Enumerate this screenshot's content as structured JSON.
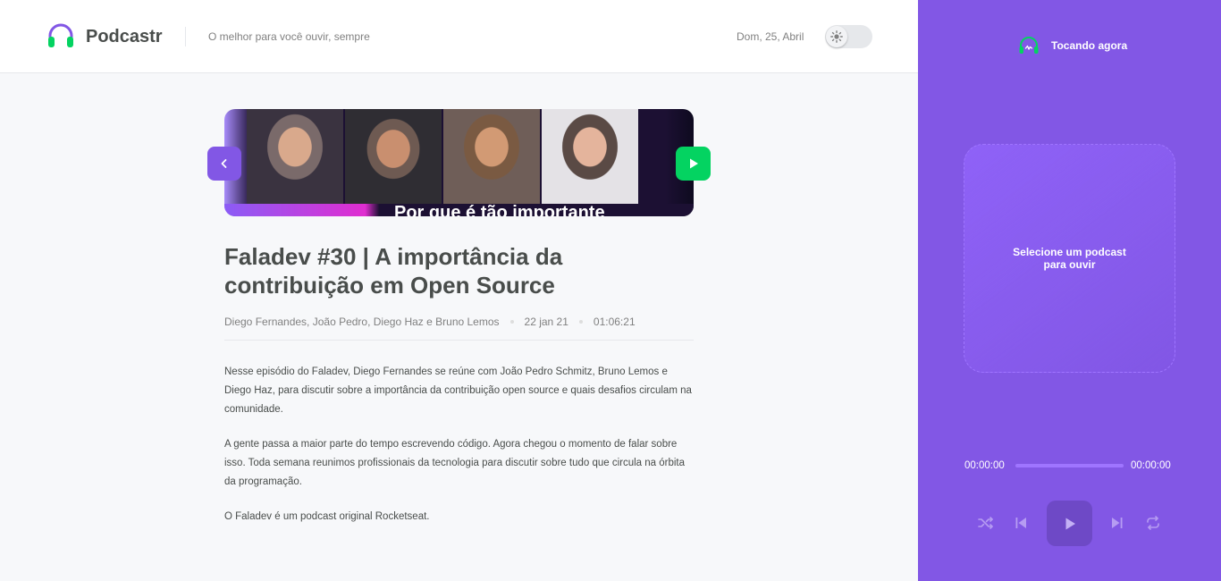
{
  "header": {
    "brand": "Podcastr",
    "tagline": "O melhor para você ouvir, sempre",
    "date": "Dom, 25, Abril",
    "theme_toggle_icon": "sun-icon"
  },
  "episode": {
    "thumbnail_caption": "Por que é tão importante",
    "title": "Faladev #30 | A importância da contribuição em Open Source",
    "members": "Diego Fernandes, João Pedro, Diego Haz e Bruno Lemos",
    "published_at": "22 jan 21",
    "duration": "01:06:21",
    "description": [
      "Nesse episódio do Faladev, Diego Fernandes se reúne com João Pedro Schmitz, Bruno Lemos e Diego Haz, para discutir sobre a importância da contribuição open source e quais desafios circulam na comunidade.",
      "A gente passa a maior parte do tempo escrevendo código. Agora chegou o momento de falar sobre isso. Toda semana reunimos profissionais da tecnologia para discutir sobre tudo que circula na órbita da programação.",
      "O Faladev é um podcast original Rocketseat."
    ]
  },
  "player": {
    "title": "Tocando agora",
    "empty_text": "Selecione um podcast para ouvir",
    "current_time": "00:00:00",
    "total_time": "00:00:00",
    "progress": 0,
    "controls": [
      "shuffle-icon",
      "previous-icon",
      "play-icon",
      "next-icon",
      "repeat-icon"
    ]
  },
  "colors": {
    "accent": "#8257E5",
    "green": "#04D361",
    "text": "#494D4B",
    "muted": "#808080",
    "background": "#F7F8FA"
  }
}
